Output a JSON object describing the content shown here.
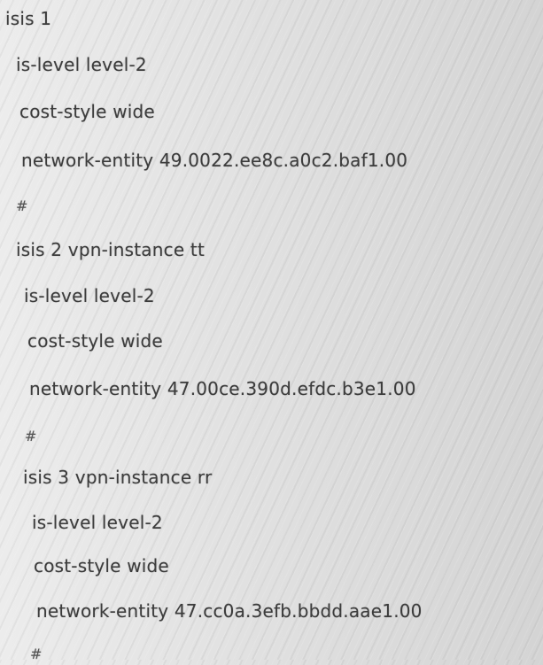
{
  "config": {
    "lines": [
      "isis 1",
      "is-level level-2",
      "cost-style wide",
      "network-entity 49.0022.ee8c.a0c2.baf1.00",
      "#",
      "isis 2 vpn-instance tt",
      "is-level level-2",
      "cost-style wide",
      "network-entity 47.00ce.390d.efdc.b3e1.00",
      "#",
      "isis 3 vpn-instance rr",
      "is-level level-2",
      "cost-style wide",
      "network-entity 47.cc0a.3efb.bbdd.aae1.00",
      "#"
    ]
  }
}
